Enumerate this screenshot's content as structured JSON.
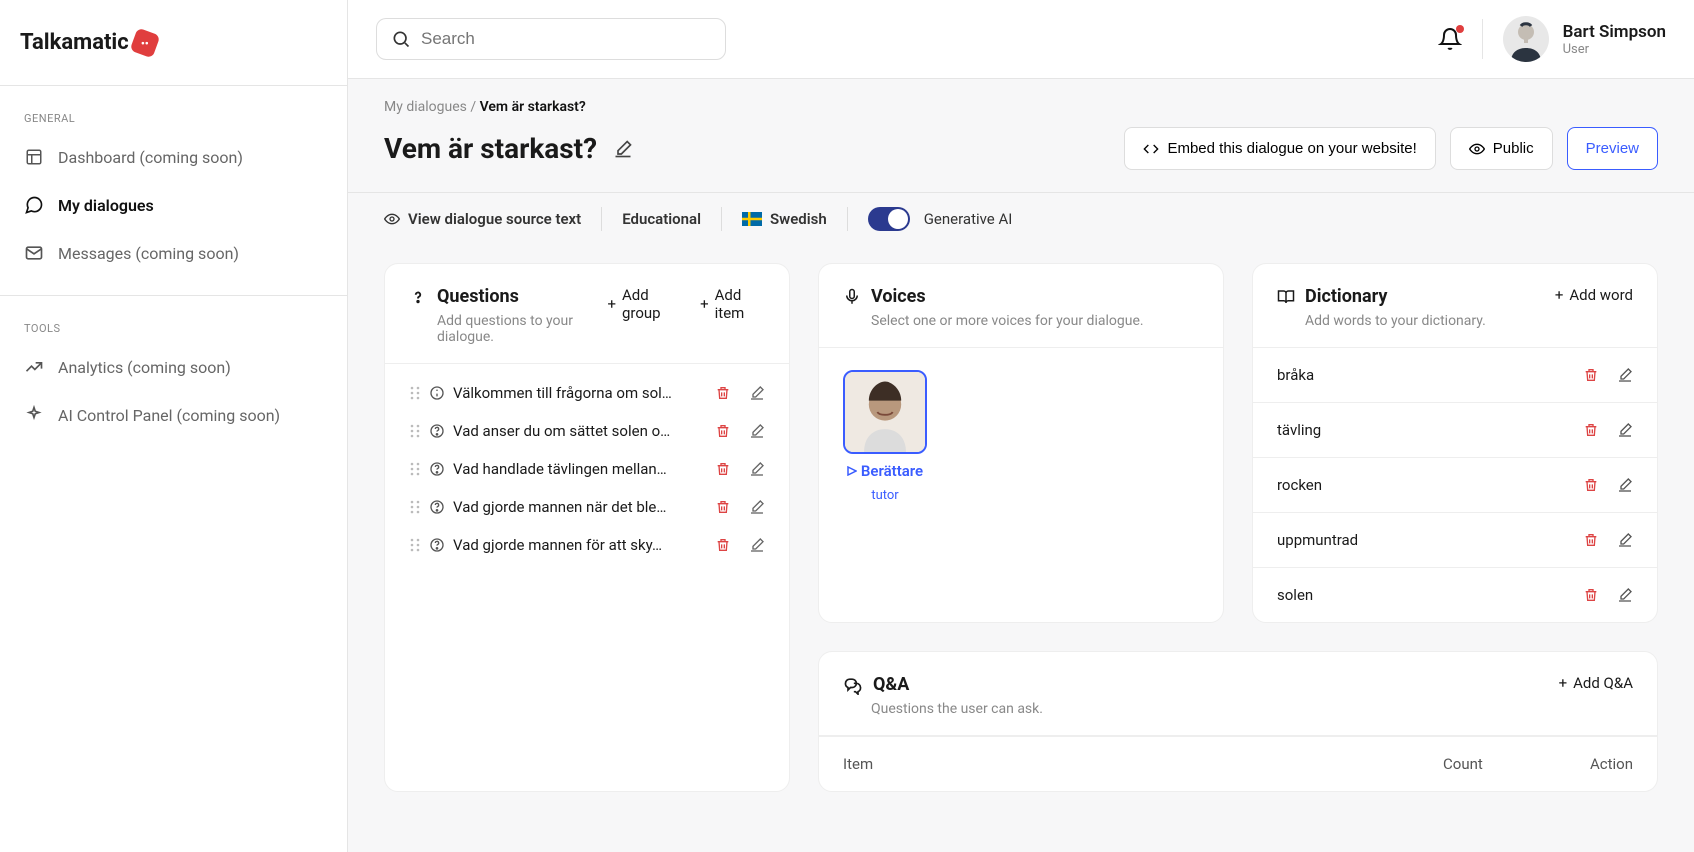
{
  "brand": "Talkamatic",
  "search": {
    "placeholder": "Search"
  },
  "user": {
    "name": "Bart Simpson",
    "role": "User"
  },
  "sidebar": {
    "sections": [
      {
        "label": "GENERAL",
        "items": [
          {
            "label": "Dashboard (coming soon)",
            "icon": "grid"
          },
          {
            "label": "My dialogues",
            "icon": "chat",
            "active": true
          },
          {
            "label": "Messages (coming soon)",
            "icon": "mail"
          }
        ]
      },
      {
        "label": "TOOLS",
        "items": [
          {
            "label": "Analytics (coming soon)",
            "icon": "trend"
          },
          {
            "label": "AI Control Panel (coming soon)",
            "icon": "sparkle"
          }
        ]
      }
    ]
  },
  "breadcrumb": {
    "root": "My dialogues",
    "sep": "/",
    "current": "Vem är starkast?"
  },
  "page": {
    "title": "Vem är starkast?"
  },
  "actions": {
    "embed": "Embed this dialogue on your website!",
    "public": "Public",
    "preview": "Preview"
  },
  "meta": {
    "view_source": "View dialogue source text",
    "category": "Educational",
    "language": "Swedish",
    "gen_ai": "Generative AI"
  },
  "questions": {
    "title": "Questions",
    "subtitle": "Add questions to your dialogue.",
    "add_group": "Add group",
    "add_item": "Add item",
    "items": [
      {
        "text": "Välkommen till frågorna om sol…",
        "kind": "info"
      },
      {
        "text": "Vad anser du om sättet solen o…",
        "kind": "q"
      },
      {
        "text": "Vad handlade tävlingen mellan…",
        "kind": "q"
      },
      {
        "text": "Vad gjorde mannen när det ble…",
        "kind": "q"
      },
      {
        "text": "Vad gjorde mannen för att sky…",
        "kind": "q"
      }
    ]
  },
  "voices": {
    "title": "Voices",
    "subtitle": "Select one or more voices for your dialogue.",
    "items": [
      {
        "name": "Berättare",
        "role": "tutor"
      }
    ]
  },
  "dictionary": {
    "title": "Dictionary",
    "subtitle": "Add words to your dictionary.",
    "add_word": "Add word",
    "items": [
      "bråka",
      "tävling",
      "rocken",
      "uppmuntrad",
      "solen"
    ]
  },
  "qa": {
    "title": "Q&A",
    "subtitle": "Questions the user can ask.",
    "add": "Add Q&A",
    "columns": {
      "item": "Item",
      "count": "Count",
      "action": "Action"
    }
  }
}
